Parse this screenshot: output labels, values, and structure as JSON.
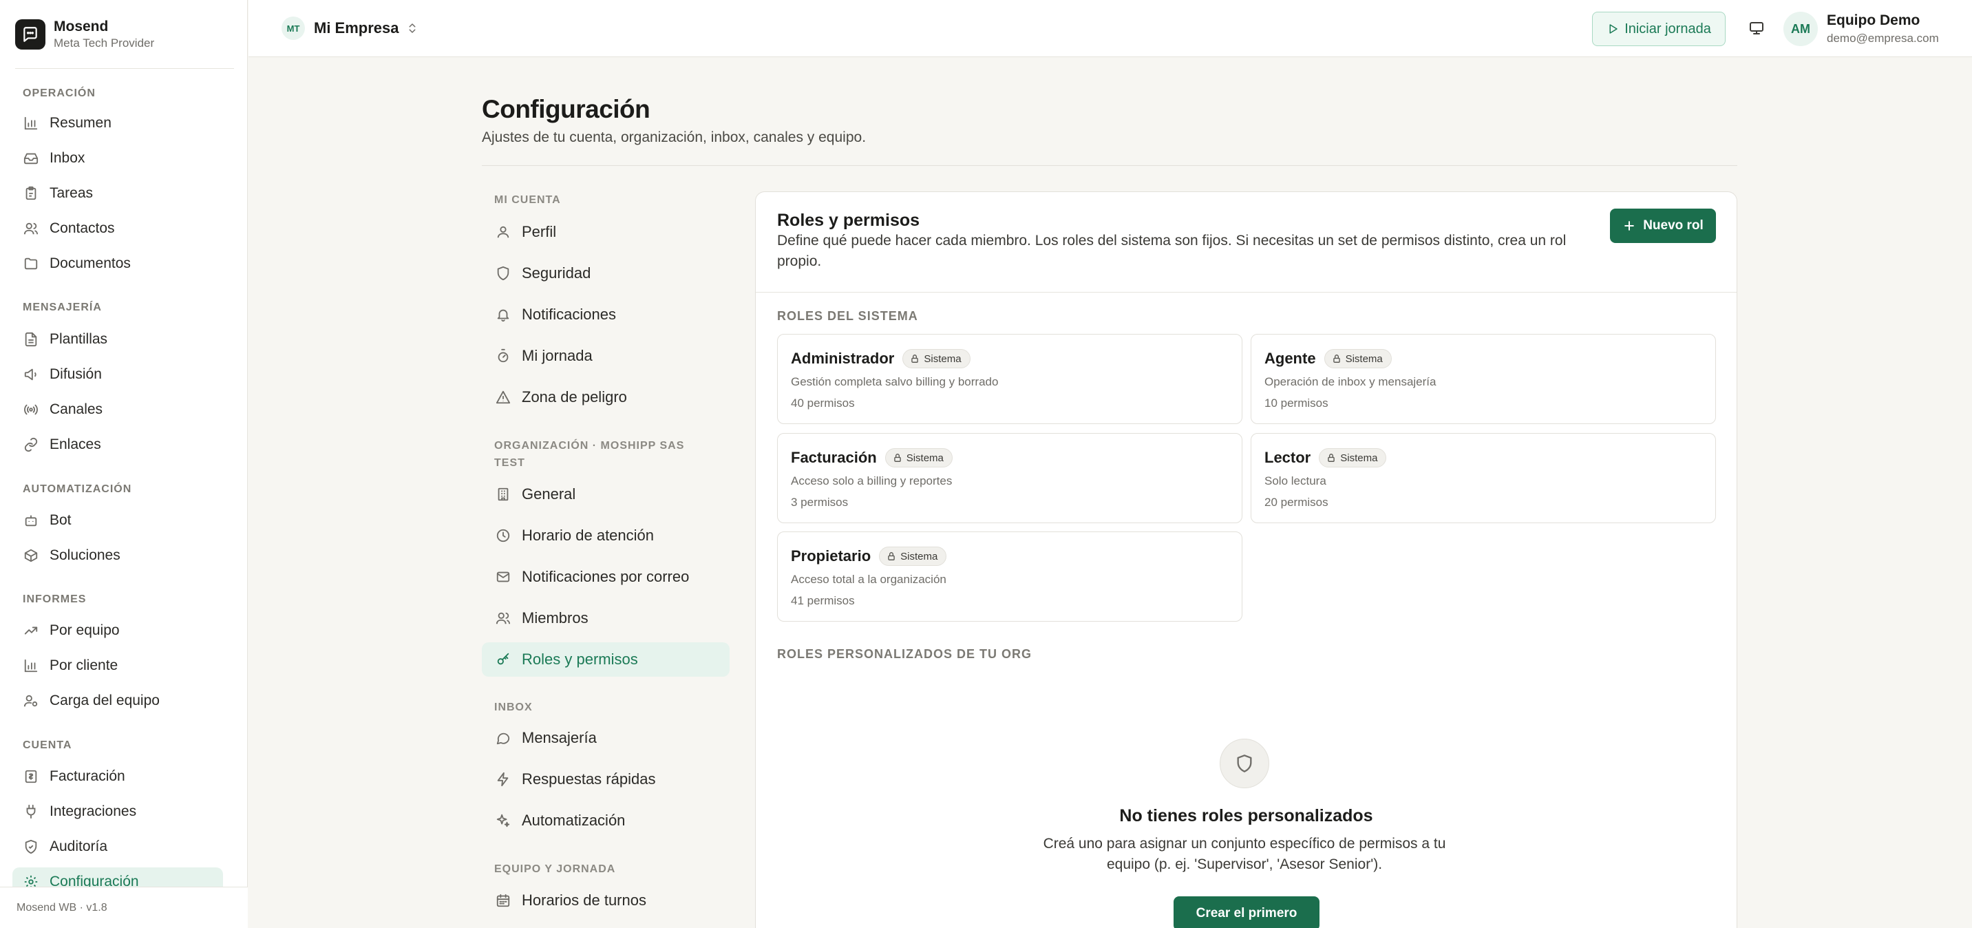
{
  "brand": {
    "name": "Mosend",
    "subtitle": "Meta Tech Provider"
  },
  "sidebar": {
    "groups": [
      {
        "label": "Operación",
        "items": [
          {
            "label": "Resumen",
            "icon": "bar-chart-icon"
          },
          {
            "label": "Inbox",
            "icon": "inbox-icon"
          },
          {
            "label": "Tareas",
            "icon": "clipboard-icon"
          },
          {
            "label": "Contactos",
            "icon": "users-icon"
          },
          {
            "label": "Documentos",
            "icon": "folder-icon"
          }
        ]
      },
      {
        "label": "Mensajería",
        "items": [
          {
            "label": "Plantillas",
            "icon": "file-text-icon"
          },
          {
            "label": "Difusión",
            "icon": "megaphone-icon"
          },
          {
            "label": "Canales",
            "icon": "radio-icon"
          },
          {
            "label": "Enlaces",
            "icon": "link-icon"
          }
        ]
      },
      {
        "label": "Automatización",
        "items": [
          {
            "label": "Bot",
            "icon": "bot-icon"
          },
          {
            "label": "Soluciones",
            "icon": "package-icon"
          }
        ]
      },
      {
        "label": "Informes",
        "items": [
          {
            "label": "Por equipo",
            "icon": "trending-up-icon"
          },
          {
            "label": "Por cliente",
            "icon": "bar-chart-icon"
          },
          {
            "label": "Carga del equipo",
            "icon": "user-cog-icon"
          }
        ]
      },
      {
        "label": "Cuenta",
        "items": [
          {
            "label": "Facturación",
            "icon": "receipt-icon"
          },
          {
            "label": "Integraciones",
            "icon": "plug-icon"
          },
          {
            "label": "Auditoría",
            "icon": "shield-check-icon"
          },
          {
            "label": "Configuración",
            "icon": "settings-icon",
            "active": true
          }
        ]
      }
    ],
    "footer": "Mosend WB · v1.8"
  },
  "topbar": {
    "org_initials": "MT",
    "org_name": "Mi Empresa",
    "start_label": "Iniciar jornada",
    "user_initials": "AM",
    "user_name": "Equipo Demo",
    "user_email": "demo@empresa.com"
  },
  "page": {
    "title": "Configuración",
    "subtitle": "Ajustes de tu cuenta, organización, inbox, canales y equipo."
  },
  "settings_nav": {
    "groups": [
      {
        "label": "Mi cuenta",
        "items": [
          {
            "label": "Perfil",
            "icon": "user-icon"
          },
          {
            "label": "Seguridad",
            "icon": "shield-icon"
          },
          {
            "label": "Notificaciones",
            "icon": "bell-icon"
          },
          {
            "label": "Mi jornada",
            "icon": "timer-icon"
          },
          {
            "label": "Zona de peligro",
            "icon": "alert-triangle-icon"
          }
        ]
      },
      {
        "label": "Organización · MOSHIPP SAS TEST",
        "items": [
          {
            "label": "General",
            "icon": "building-icon"
          },
          {
            "label": "Horario de atención",
            "icon": "clock-icon"
          },
          {
            "label": "Notificaciones por correo",
            "icon": "mail-icon"
          },
          {
            "label": "Miembros",
            "icon": "users-icon"
          },
          {
            "label": "Roles y permisos",
            "icon": "key-icon",
            "active": true
          }
        ]
      },
      {
        "label": "Inbox",
        "items": [
          {
            "label": "Mensajería",
            "icon": "message-circle-icon"
          },
          {
            "label": "Respuestas rápidas",
            "icon": "zap-icon"
          },
          {
            "label": "Automatización",
            "icon": "sparkles-icon"
          }
        ]
      },
      {
        "label": "Equipo y jornada",
        "items": [
          {
            "label": "Horarios de turnos",
            "icon": "calendar-icon"
          }
        ]
      }
    ]
  },
  "roles": {
    "title": "Roles y permisos",
    "description": "Define qué puede hacer cada miembro. Los roles del sistema son fijos. Si necesitas un set de permisos distinto, crea un rol propio.",
    "new_role_label": "Nuevo rol",
    "system_label": "Roles del sistema",
    "badge_label": "Sistema",
    "system_roles": [
      {
        "name": "Administrador",
        "desc": "Gestión completa salvo billing y borrado",
        "count": "40 permisos"
      },
      {
        "name": "Agente",
        "desc": "Operación de inbox y mensajería",
        "count": "10 permisos"
      },
      {
        "name": "Facturación",
        "desc": "Acceso solo a billing y reportes",
        "count": "3 permisos"
      },
      {
        "name": "Lector",
        "desc": "Solo lectura",
        "count": "20 permisos"
      },
      {
        "name": "Propietario",
        "desc": "Acceso total a la organización",
        "count": "41 permisos"
      }
    ],
    "custom_label": "Roles personalizados de tu org",
    "empty_title": "No tienes roles personalizados",
    "empty_desc": "Creá uno para asignar un conjunto específico de permisos a tu equipo (p. ej. 'Supervisor', 'Asesor Senior').",
    "create_first_label": "Crear el primero"
  },
  "colors": {
    "accent": "#1b6e4d",
    "accent_soft": "#e6f3ed",
    "background": "#f7f6f2"
  }
}
